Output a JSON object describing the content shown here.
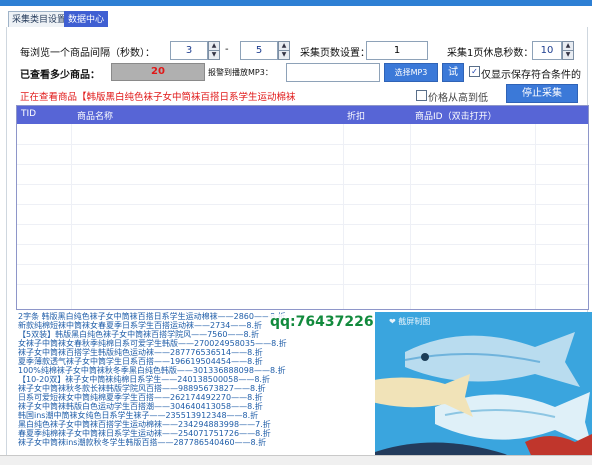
{
  "tabs": [
    {
      "label": "采集类目设置",
      "active": false
    },
    {
      "label": "数据中心",
      "active": true
    }
  ],
  "settings": {
    "interval_label": "每浏览一个商品间隔（秒数）：",
    "interval_min": "3",
    "dash": "-",
    "interval_max": "5",
    "pages_label": "采集页数设置：",
    "pages_value": "1",
    "rest_label": "采集1页休息秒数：",
    "rest_value": "10",
    "viewed_label": "已查看多少商品：",
    "viewed_count": "20",
    "music_label": "报警到播放MP3：",
    "music_value": "",
    "choose_mp3": "选择MP3",
    "test_label": "试",
    "only_match_label": "仅显示保存符合条件的",
    "only_match_checked": true,
    "status_text": "正在查看商品【韩版黑白纯色袜子女中筒袜百搭日系学生运动棉袜",
    "price_sort_label": "价格从高到低",
    "price_sort_checked": false,
    "stop_button": "停止采集"
  },
  "table": {
    "columns": [
      "TID",
      "商品名称",
      "折扣",
      "商品ID（双击打开）"
    ],
    "rows": []
  },
  "log_lines": [
    "2字条 韩版黑白纯色袜子女中筒袜百搭日系学生运动棉袜——2860——8.折",
    "新款纯棉短袜中筒袜女春夏季日系学生百搭运动袜——2734——8.折",
    "【5双装】韩版黑白纯色袜子女中筒袜百搭学院风——7560——8.折",
    "女袜子中筒袜女春秋季纯棉日系可爱学生韩版——270024958035——8.折",
    "袜子女中筒袜百搭学生韩版纯色运动袜——287776536514——8.折",
    "夏季薄款透气袜子女中筒学生日系百搭——196619504454——8.折",
    "100%纯棉袜子女中筒袜秋冬季黑白纯色韩版——301336888098——8.折",
    "【10-20双】袜子女中筒袜纯棉日系学生——240138500058——8.折",
    "袜子女中筒袜秋冬款长袜韩版学院风百搭——98895673827——8.折",
    "日系可爱短袜女中筒纯棉夏季学生百搭——262174492270——8.折",
    "袜子女中筒袜韩版白色运动学生百搭潮——304640413058——8.折",
    "韩国ins潮中筒袜女纯色日系学生袜子——235513912348——8.折",
    "黑白纯色袜子女中筒袜百搭学生运动棉袜——234294883998——7.折",
    "春夏季纯棉袜子女中筒袜日系学生运动袜——254071751726——8.折",
    "袜子女中筒袜ins潮款秋冬学生韩版百搭——287786540460——8.折"
  ],
  "watermark": "qq:76437226",
  "overlay_caption": "❤ 截屏制图"
}
